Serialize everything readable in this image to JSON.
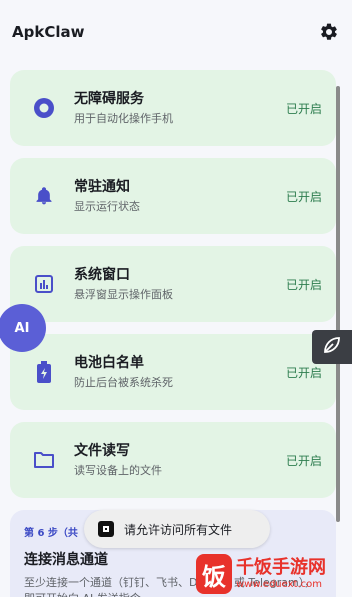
{
  "app": {
    "title": "ApkClaw"
  },
  "colors": {
    "card_bg": "#e3f4e5",
    "accent": "#5b5fd6",
    "status": "#2e7d4f"
  },
  "cards": [
    {
      "icon": "accessibility-icon",
      "title": "无障碍服务",
      "subtitle": "用于自动化操作手机",
      "status": "已开启"
    },
    {
      "icon": "bell-icon",
      "title": "常驻通知",
      "subtitle": "显示运行状态",
      "status": "已开启"
    },
    {
      "icon": "window-chart-icon",
      "title": "系统窗口",
      "subtitle": "悬浮窗显示操作面板",
      "status": "已开启"
    },
    {
      "icon": "battery-icon",
      "title": "电池白名单",
      "subtitle": "防止后台被系统杀死",
      "status": "已开启"
    },
    {
      "icon": "folder-icon",
      "title": "文件读写",
      "subtitle": "读写设备上的文件",
      "status": "已开启"
    }
  ],
  "fab": {
    "label": "AI"
  },
  "step": {
    "label": "第 6 步（共",
    "title": "连接消息通道",
    "desc": "至少连接一个通道（钉钉、飞书、Discord 或 Telegram），即可开始向 AI 发送指令"
  },
  "toast": {
    "text": "请允许访问所有文件"
  },
  "watermark": {
    "name": "千饭手游网",
    "url": "www.eduext.com",
    "logo_char": "饭"
  }
}
